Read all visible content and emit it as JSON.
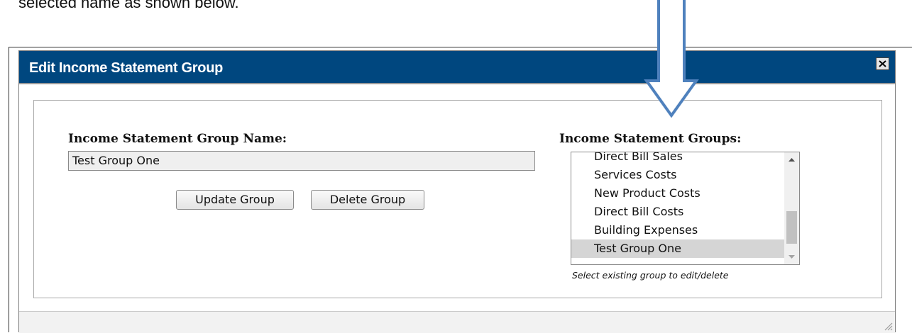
{
  "caption": "selected name as shown below.",
  "dialog": {
    "title": "Edit Income Statement Group",
    "close_icon": "close-icon"
  },
  "form": {
    "name_label": "Income Statement Group Name:",
    "name_value": "Test Group One",
    "update_label": "Update Group",
    "delete_label": "Delete Group",
    "groups_label": "Income Statement Groups:",
    "groups": [
      "Direct Bill Sales",
      "Services Costs",
      "New Product Costs",
      "Direct Bill Costs",
      "Building Expenses",
      "Test Group One"
    ],
    "selected_group": "Test Group One",
    "hint": "Select existing group to edit/delete"
  },
  "colors": {
    "titlebar": "#00477f",
    "arrow": "#4f81bd",
    "selected_row": "#d5d5d5"
  }
}
